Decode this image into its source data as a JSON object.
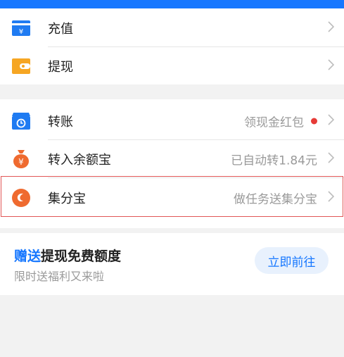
{
  "colors": {
    "accent": "#1677ff",
    "alert": "#e63b37",
    "highlight_border": "#e15656"
  },
  "groups": [
    {
      "items": [
        {
          "icon": "card-icon",
          "label": "充值",
          "right_text": ""
        },
        {
          "icon": "wallet-icon",
          "label": "提现",
          "right_text": ""
        }
      ]
    },
    {
      "items": [
        {
          "icon": "transfer-shop-icon",
          "label": "转账",
          "right_text": "领现金红包",
          "badge": true
        },
        {
          "icon": "money-bag-icon",
          "label": "转入余额宝",
          "right_text": "已自动转1.84元"
        },
        {
          "icon": "jifenbao-icon",
          "label": "集分宝",
          "right_text": "做任务送集分宝",
          "highlighted": true
        }
      ]
    }
  ],
  "promo": {
    "title_accent": "赠送",
    "title_rest": "提现免费额度",
    "subtitle": "限时送福利又来啦",
    "button_label": "立即前往"
  }
}
